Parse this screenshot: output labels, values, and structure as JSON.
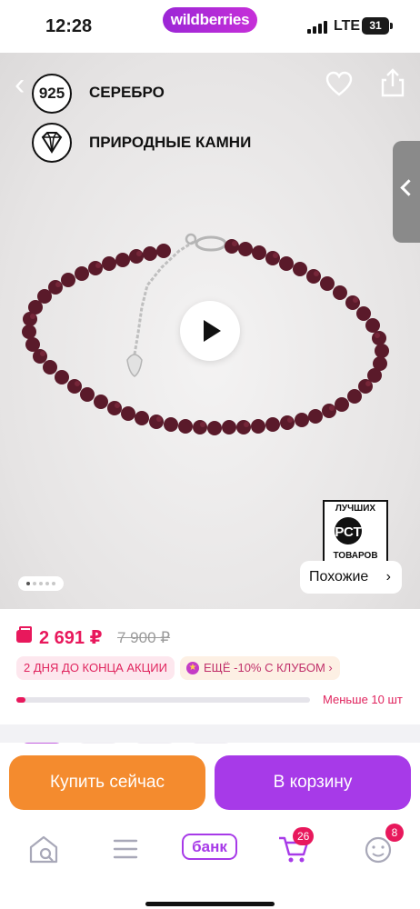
{
  "status_bar": {
    "time": "12:28",
    "app_pill": "wildberries",
    "network": "LTE",
    "battery": "31"
  },
  "gallery": {
    "badges": [
      {
        "icon": "925",
        "label": "СЕРЕБРО"
      },
      {
        "icon": "diamond-icon",
        "label": "ПРИРОДНЫЕ КАМНИ"
      }
    ],
    "similar_label": "Похожие",
    "similar_chevron": "›",
    "slide_count": 5,
    "active_slide": 1,
    "logo_text": [
      "ЛУЧШИХ",
      "РСТ",
      "ТОВАРОВ"
    ]
  },
  "price": {
    "current": "2 691 ₽",
    "old": "7 900 ₽",
    "promo_days": "2 ДНЯ ДО КОНЦА АКЦИИ",
    "promo_club": "ЕЩЁ -10% С КЛУБОМ ›",
    "stock_text": "Меньше 10 шт",
    "stock_fraction": 0.03
  },
  "actions": {
    "buy_now": "Купить сейчас",
    "add_to_cart": "В корзину"
  },
  "nav": {
    "bank": "банк",
    "cart_count": "26",
    "profile_count": "8"
  },
  "colors": {
    "accent_purple": "#a73ae8",
    "accent_orange": "#f48b2e",
    "price_red": "#e8185c"
  }
}
